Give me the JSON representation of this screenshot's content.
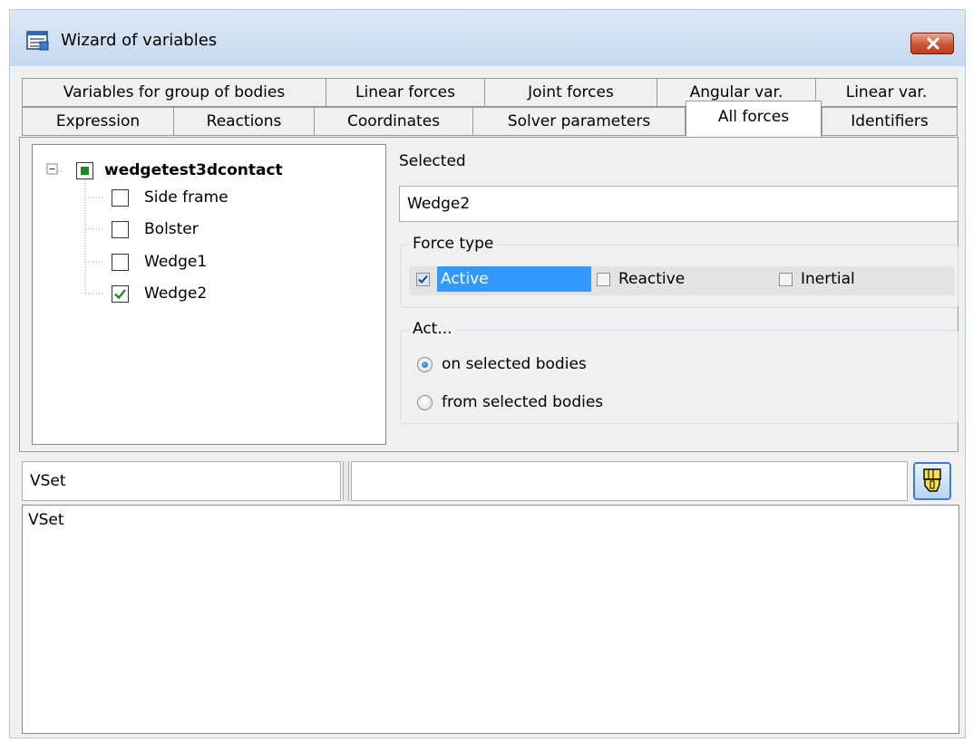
{
  "window": {
    "title": "Wizard of variables"
  },
  "icons": {
    "app": "app-icon",
    "close": "close-icon",
    "pointer": "hand-pointer-icon"
  },
  "tabs_row1": [
    "Variables for group of bodies",
    "Linear forces",
    "Joint forces",
    "Angular var.",
    "Linear var."
  ],
  "tabs_row2": [
    "Expression",
    "Reactions",
    "Coordinates",
    "Solver parameters",
    "All forces",
    "Identifiers"
  ],
  "active_tab": "All forces",
  "tree": {
    "root_label": "wedgetest3dcontact",
    "items": [
      {
        "label": "Side frame",
        "checked": false
      },
      {
        "label": "Bolster",
        "checked": false
      },
      {
        "label": "Wedge1",
        "checked": false
      },
      {
        "label": "Wedge2",
        "checked": true
      }
    ]
  },
  "selected": {
    "label": "Selected",
    "value": "Wedge2"
  },
  "force_type": {
    "legend": "Force type",
    "options": [
      {
        "label": "Active",
        "checked": true
      },
      {
        "label": "Reactive",
        "checked": false
      },
      {
        "label": "Inertial",
        "checked": false
      }
    ]
  },
  "act": {
    "legend": "Act...",
    "options": [
      {
        "label": "on selected bodies",
        "checked": true
      },
      {
        "label": "from selected bodies",
        "checked": false
      }
    ]
  },
  "bottom": {
    "name_value": "VSet",
    "expression_value": "",
    "output_text": "VSet"
  },
  "colors": {
    "selection": "#3399ff",
    "check_green": "#1e8a1e",
    "title_bar": "#c6d9ee"
  }
}
